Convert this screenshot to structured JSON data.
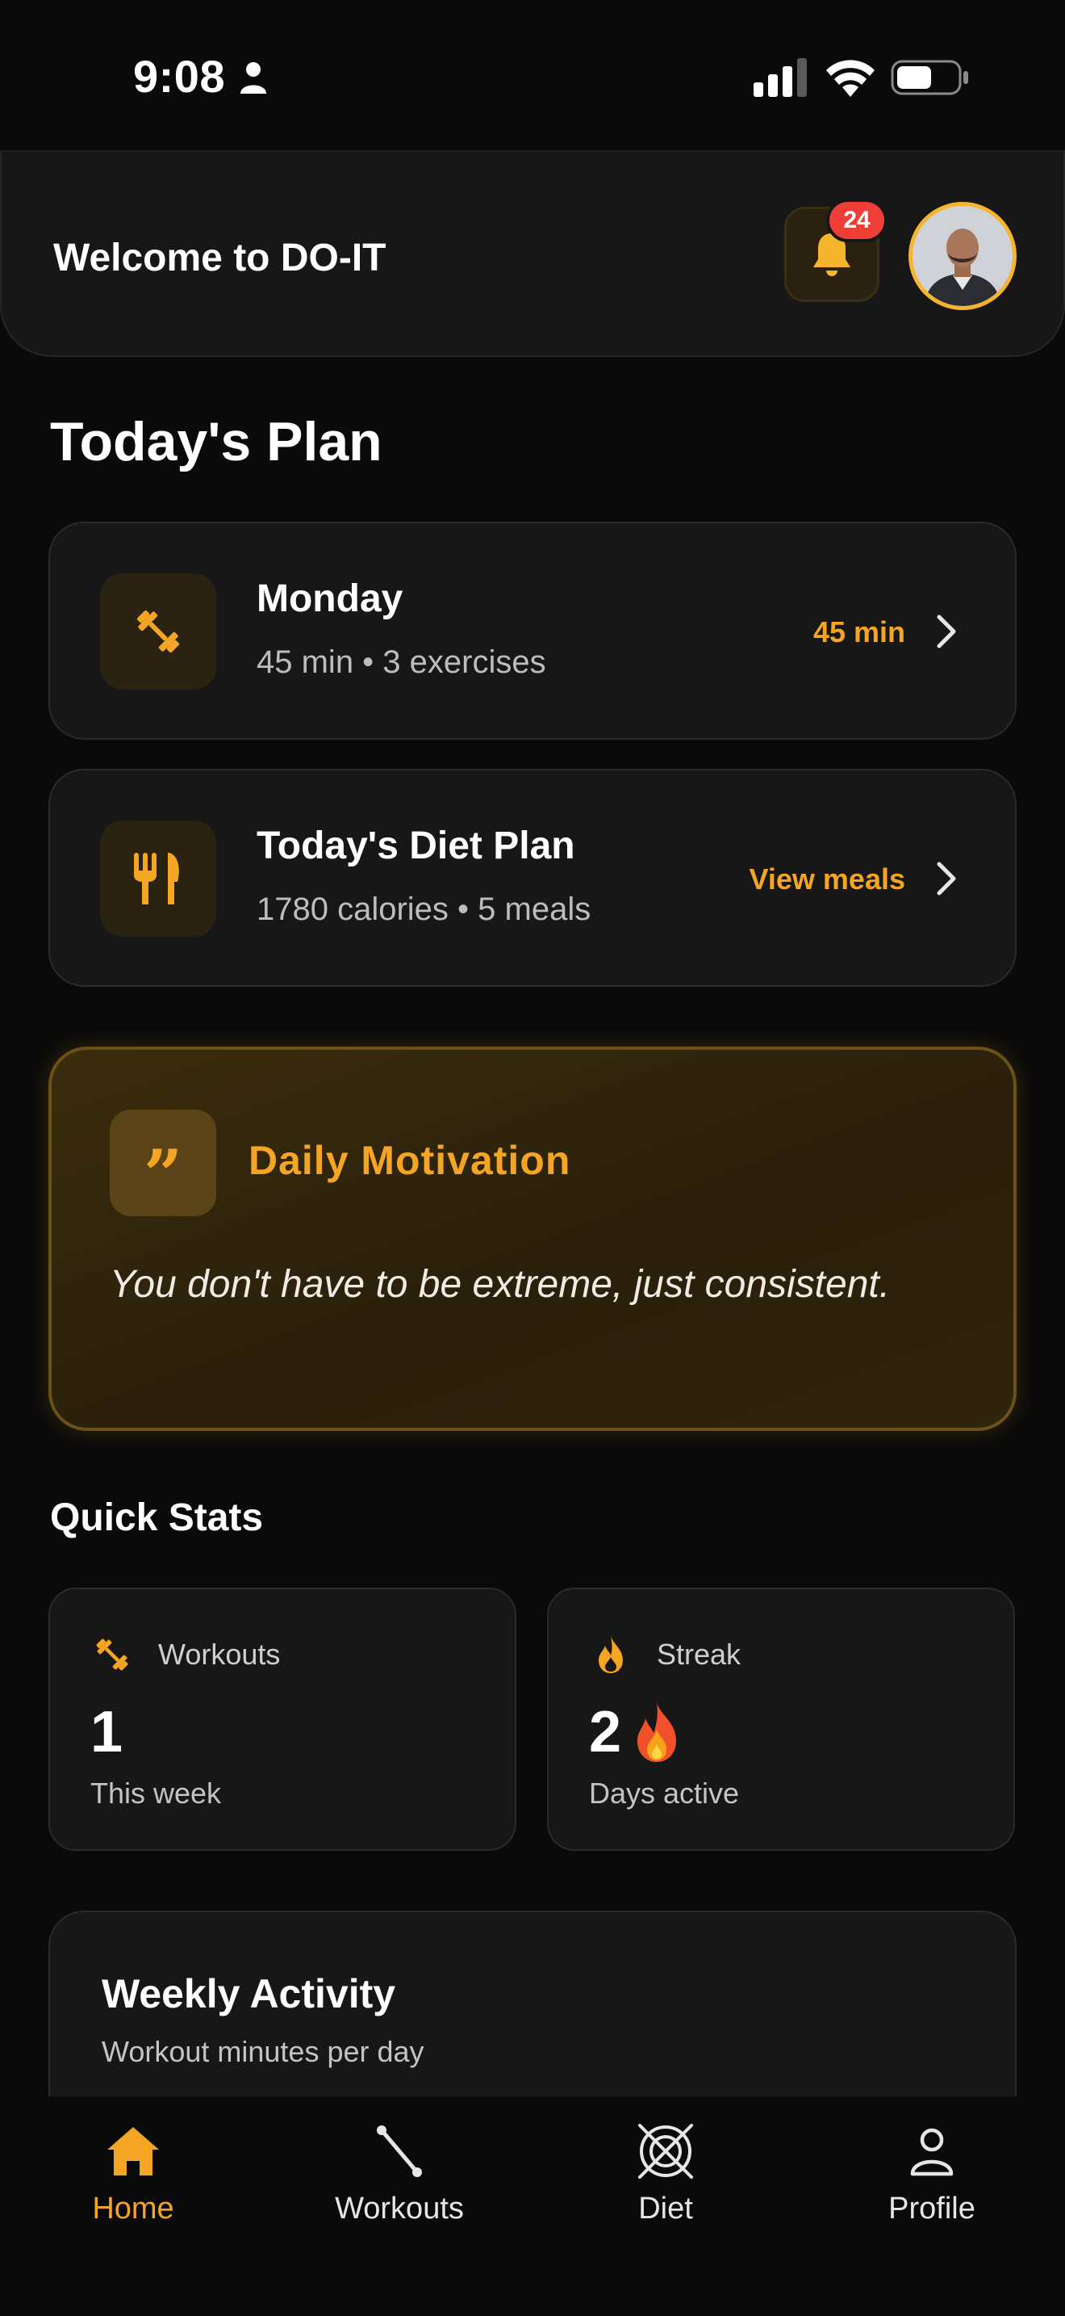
{
  "status_bar": {
    "time": "9:08"
  },
  "header": {
    "welcome": "Welcome to DO-IT",
    "notification_count": "24"
  },
  "todays_plan": {
    "title": "Today's Plan",
    "workout": {
      "title": "Monday",
      "subtitle": "45 min • 3 exercises",
      "action": "45 min",
      "icon": "dumbbell-icon"
    },
    "diet": {
      "title": "Today's Diet Plan",
      "subtitle": "1780 calories • 5 meals",
      "action": "View meals",
      "icon": "fork-knife-icon"
    }
  },
  "motivation": {
    "title": "Daily Motivation",
    "quote": "You don't have to be extreme, just consistent."
  },
  "quick_stats": {
    "title": "Quick Stats",
    "workouts": {
      "label": "Workouts",
      "value": "1",
      "sub": "This week"
    },
    "streak": {
      "label": "Streak",
      "value": "2",
      "sub": "Days active"
    }
  },
  "weekly_activity": {
    "title": "Weekly Activity",
    "subtitle": "Workout minutes per day"
  },
  "bottom_nav": {
    "items": [
      {
        "label": "Home",
        "icon": "home-icon",
        "active": true
      },
      {
        "label": "Workouts",
        "icon": "workout-icon",
        "active": false
      },
      {
        "label": "Diet",
        "icon": "diet-icon",
        "active": false
      },
      {
        "label": "Profile",
        "icon": "profile-icon",
        "active": false
      }
    ]
  },
  "colors": {
    "accent": "#f5a524",
    "background": "#0a0a0a",
    "card": "#171717",
    "badge": "#ef3e36"
  }
}
